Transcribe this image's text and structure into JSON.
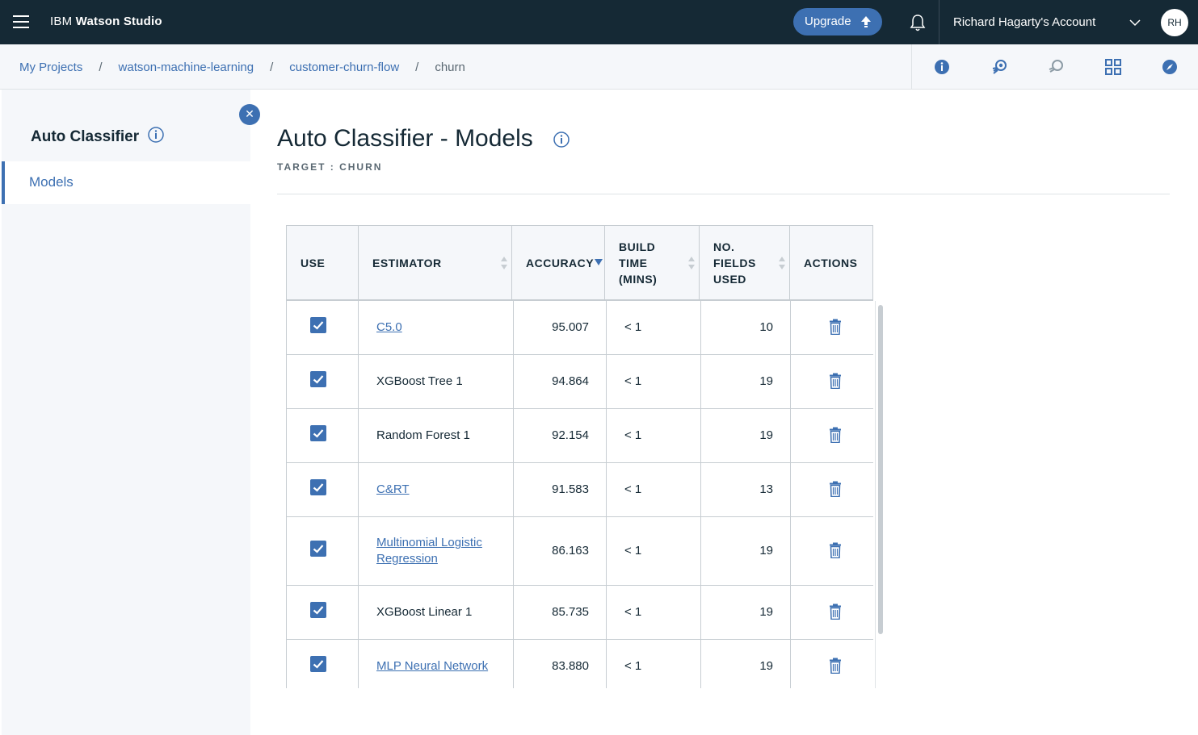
{
  "header": {
    "brand_prefix": "IBM",
    "brand_name": "Watson Studio",
    "upgrade_label": "Upgrade",
    "account_name": "Richard Hagarty's Account",
    "avatar_initials": "RH"
  },
  "breadcrumb": {
    "items": [
      "My Projects",
      "watson-machine-learning",
      "customer-churn-flow"
    ],
    "current": "churn",
    "separator": "/"
  },
  "sidebar": {
    "title": "Auto Classifier",
    "items": [
      {
        "label": "Models",
        "active": true
      }
    ]
  },
  "main": {
    "title": "Auto Classifier - Models",
    "target_label": "TARGET : CHURN"
  },
  "table": {
    "headers": {
      "use": "USE",
      "estimator": "ESTIMATOR",
      "accuracy": "ACCURACY",
      "build_time_l1": "BUILD",
      "build_time_l2": "TIME",
      "build_time_l3": "(MINS)",
      "fields_l1": "NO.",
      "fields_l2": "FIELDS",
      "fields_l3": "USED",
      "actions": "ACTIONS"
    },
    "sorted_column": "accuracy",
    "sort_direction": "descending",
    "rows": [
      {
        "use": true,
        "estimator": "C5.0",
        "estimator_l2": "",
        "is_link": true,
        "accuracy": "95.007",
        "build_time": "< 1",
        "fields": "10"
      },
      {
        "use": true,
        "estimator": "XGBoost Tree 1",
        "estimator_l2": "",
        "is_link": false,
        "accuracy": "94.864",
        "build_time": "< 1",
        "fields": "19"
      },
      {
        "use": true,
        "estimator": "Random Forest 1",
        "estimator_l2": "",
        "is_link": false,
        "accuracy": "92.154",
        "build_time": "< 1",
        "fields": "19"
      },
      {
        "use": true,
        "estimator": "C&RT",
        "estimator_l2": "",
        "is_link": true,
        "accuracy": "91.583",
        "build_time": "< 1",
        "fields": "13"
      },
      {
        "use": true,
        "estimator": "Multinomial Logistic",
        "estimator_l2": "Regression",
        "is_link": true,
        "accuracy": "86.163",
        "build_time": "< 1",
        "fields": "19"
      },
      {
        "use": true,
        "estimator": "XGBoost Linear 1",
        "estimator_l2": "",
        "is_link": false,
        "accuracy": "85.735",
        "build_time": "< 1",
        "fields": "19"
      },
      {
        "use": true,
        "estimator": "MLP Neural Network",
        "estimator_l2": "",
        "is_link": true,
        "accuracy": "83.880",
        "build_time": "< 1",
        "fields": "19"
      }
    ]
  },
  "colors": {
    "header_bg": "#152935",
    "accent": "#3d70b2",
    "panel_bg": "#f5f7fa",
    "border": "#c7cdd2"
  }
}
